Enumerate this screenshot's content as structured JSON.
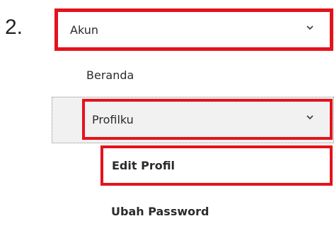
{
  "step": {
    "number": "2."
  },
  "menu": {
    "akun": {
      "label": "Akun",
      "expanded": true,
      "icon": "chevron-down-icon"
    },
    "beranda": {
      "label": "Beranda"
    },
    "profilku": {
      "label": "Profilku",
      "expanded": true,
      "icon": "chevron-down-icon"
    },
    "edit_profil": {
      "label": "Edit Profil"
    },
    "ubah_password": {
      "label": "Ubah Password"
    }
  },
  "colors": {
    "highlight": "#e4121c",
    "selected_background": "#f1f1f1",
    "text": "#2b2b2b"
  }
}
